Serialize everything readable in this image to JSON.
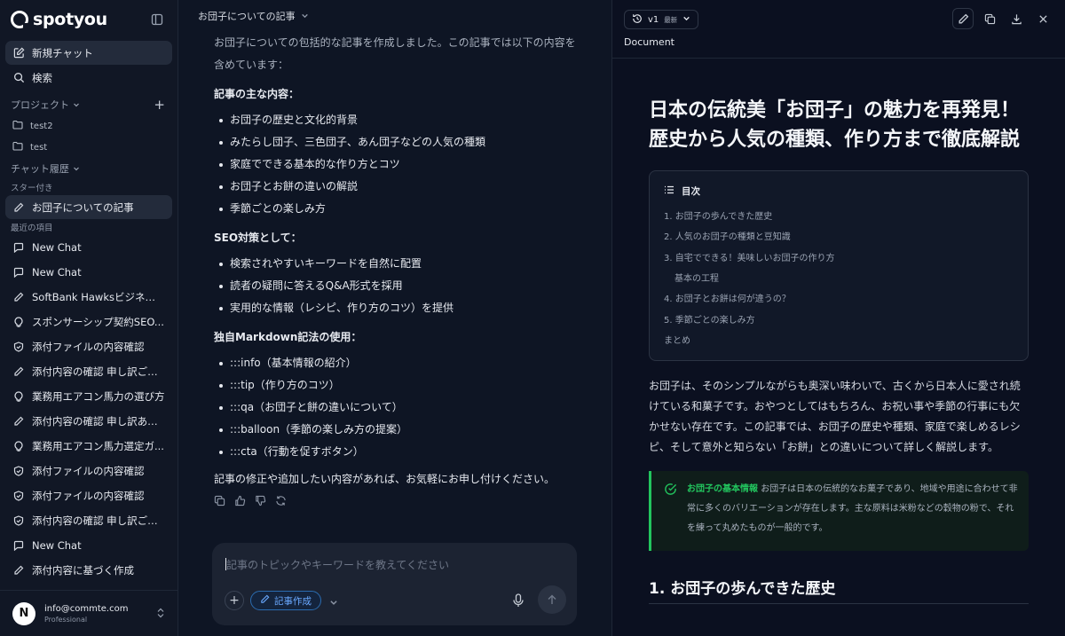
{
  "sidebar": {
    "brand": "spotyou",
    "new_chat": "新規チャット",
    "search": "検索",
    "projects_label": "プロジェクト",
    "projects": [
      "test2",
      "test"
    ],
    "history_label": "チャット履歴",
    "starred_label": "スター付き",
    "starred": [
      "お団子についての記事"
    ],
    "recent_label": "最近の項目",
    "recent": [
      {
        "icon": "chat-bubble-icon",
        "label": "New Chat"
      },
      {
        "icon": "chat-bubble-icon",
        "label": "New Chat"
      },
      {
        "icon": "pencil-icon",
        "label": "SoftBank Hawksビジネスサ..."
      },
      {
        "icon": "lightbulb-icon",
        "label": "スポンサーシップ契約SEO..."
      },
      {
        "icon": "shield-check-icon",
        "label": "添付ファイルの内容確認"
      },
      {
        "icon": "pencil-icon",
        "label": "添付内容の確認 申し訳ござ..."
      },
      {
        "icon": "lightbulb-icon",
        "label": "業務用エアコン馬力の選び方"
      },
      {
        "icon": "pencil-icon",
        "label": "添付内容の確認 申し訳あり..."
      },
      {
        "icon": "lightbulb-icon",
        "label": "業務用エアコン馬力選定ガ..."
      },
      {
        "icon": "shield-check-icon",
        "label": "添付ファイルの内容確認"
      },
      {
        "icon": "shield-check-icon",
        "label": "添付ファイルの内容確認"
      },
      {
        "icon": "shield-check-icon",
        "label": "添付内容の確認 申し訳ござ..."
      },
      {
        "icon": "chat-bubble-icon",
        "label": "New Chat"
      },
      {
        "icon": "pencil-icon",
        "label": "添付内容に基づく作成"
      }
    ],
    "user": {
      "initial": "N",
      "email": "info@commte.com",
      "plan": "Professional"
    }
  },
  "chat": {
    "title": "お団子についての記事",
    "intro": "お団子についての包括的な記事を作成しました。この記事では以下の内容を含めています：",
    "section1_title": "記事の主な内容：",
    "section1_items": [
      "お団子の歴史と文化的背景",
      "みたらし団子、三色団子、あん団子などの人気の種類",
      "家庭でできる基本的な作り方とコツ",
      "お団子とお餅の違いの解説",
      "季節ごとの楽しみ方"
    ],
    "section2_title": "SEO対策として：",
    "section2_items": [
      "検索されやすいキーワードを自然に配置",
      "読者の疑問に答えるQ&A形式を採用",
      "実用的な情報（レシピ、作り方のコツ）を提供"
    ],
    "section3_title": "独自Markdown記法の使用：",
    "section3_items": [
      ":::info（基本情報の紹介）",
      ":::tip（作り方のコツ）",
      ":::qa（お団子と餅の違いについて）",
      ":::balloon（季節の楽しみ方の提案）",
      ":::cta（行動を促すボタン）"
    ],
    "closing": "記事の修正や追加したい内容があれば、お気軽にお申し付けください。",
    "composer": {
      "placeholder": "記事のトピックやキーワードを教えてください",
      "mode_chip": "記事作成"
    }
  },
  "doc": {
    "version": "v1",
    "version_badge": "最新",
    "label": "Document",
    "title": "日本の伝統美「お団子」の魅力を再発見！歴史から人気の種類、作り方まで徹底解説",
    "toc_title": "目次",
    "toc": [
      {
        "text": "1. お団子の歩んできた歴史",
        "indent": false
      },
      {
        "text": "2. 人気のお団子の種類と豆知識",
        "indent": false
      },
      {
        "text": "3. 自宅でできる！美味しいお団子の作り方",
        "indent": false
      },
      {
        "text": "基本の工程",
        "indent": true
      },
      {
        "text": "4. お団子とお餅は何が違うの？",
        "indent": false
      },
      {
        "text": "5. 季節ごとの楽しみ方",
        "indent": false
      },
      {
        "text": "まとめ",
        "indent": false
      }
    ],
    "paragraph": "お団子は、そのシンプルながらも奥深い味わいで、古くから日本人に愛され続けている和菓子です。おやつとしてはもちろん、お祝い事や季節の行事にも欠かせない存在です。この記事では、お団子の歴史や種類、家庭で楽しめるレシピ、そして意外と知らない「お餅」との違いについて詳しく解説します。",
    "callout_title": "お団子の基本情報",
    "callout_text": "お団子は日本の伝統的なお菓子であり、地域や用途に合わせて非常に多くのバリエーションが存在します。主な原料は米粉などの穀物の粉で、それを練って丸めたものが一般的です。",
    "section_heading": "1. お団子の歩んできた歴史"
  }
}
